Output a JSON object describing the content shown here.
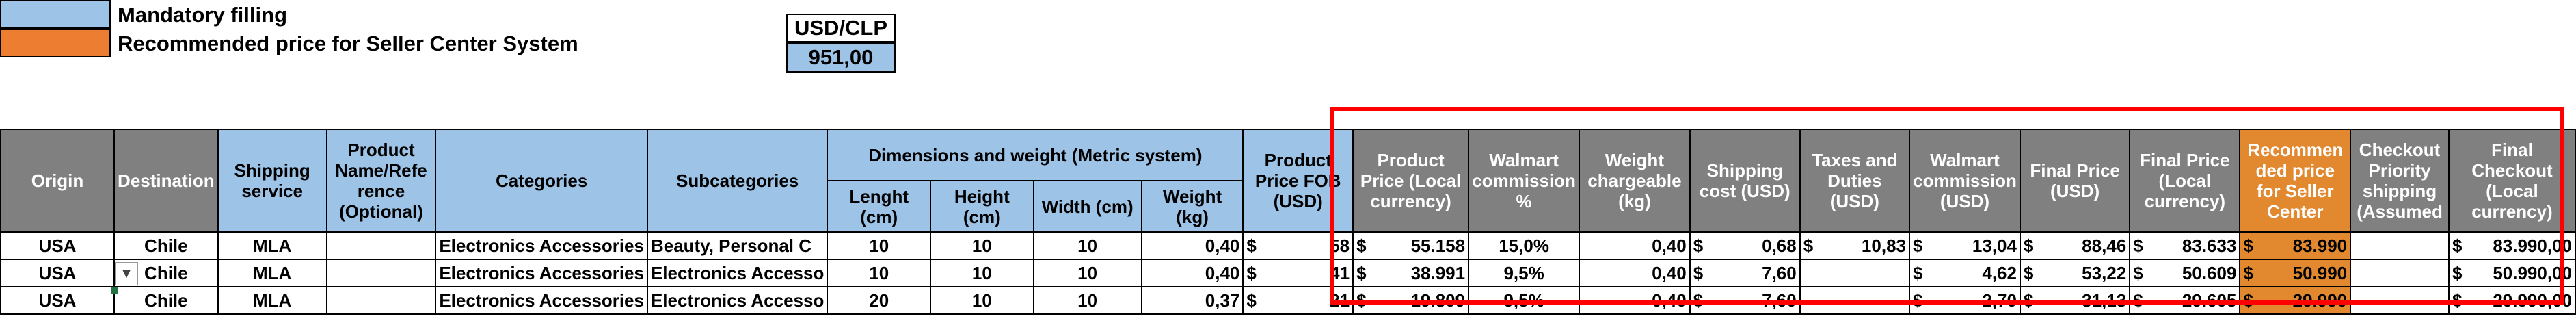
{
  "legend": {
    "mandatory_label": "Mandatory filling",
    "recommended_label": "Recommended price for Seller Center System",
    "mandatory_color": "#9dc3e6",
    "recommended_color": "#ed7d31"
  },
  "fx": {
    "label": "USD/CLP",
    "value": "951,00"
  },
  "headers": {
    "origin": "Origin",
    "destination": "Destination",
    "shipping_service": "Shipping service",
    "product_name": "Product Name/Refe rence (Optional)",
    "categories": "Categories",
    "subcategories": "Subcategories",
    "dimensions_group": "Dimensions and weight (Metric system)",
    "length": "Lenght (cm)",
    "height": "Height (cm)",
    "width": "Width (cm)",
    "weight": "Weight (kg)",
    "price_fob": "Product Price FOB (USD)",
    "price_local": "Product Price (Local currency)",
    "walmart_commission_pct": "Walmart commission %",
    "weight_chargeable": "Weight chargeable (kg)",
    "shipping_cost": "Shipping cost (USD)",
    "taxes": "Taxes and Duties (USD)",
    "walmart_commission_usd": "Walmart commission (USD)",
    "final_price_usd": "Final Price (USD)",
    "final_price_local": "Final Price (Local currency)",
    "recommended_price": "Recommen ded price for Seller Center",
    "checkout_priority": "Checkout Priority shipping (Assumed",
    "final_checkout": "Final Checkout (Local currency)"
  },
  "rows": [
    {
      "origin": "USA",
      "destination": "Chile",
      "service": "MLA",
      "name": "",
      "category": "Electronics Accessories",
      "subcategory": "Beauty, Personal C",
      "length": "10",
      "height": "10",
      "width": "10",
      "weight": "0,40",
      "fob_cur": "$",
      "fob": "58",
      "local_cur": "$",
      "local": "55.158",
      "commission_pct": "15,0%",
      "weight_chargeable": "0,40",
      "ship_cur": "$",
      "ship": "0,68",
      "tax_cur": "$",
      "tax": "10,83",
      "comm_cur": "$",
      "comm": "13,04",
      "final_usd_cur": "$",
      "final_usd": "88,46",
      "final_local_cur": "$",
      "final_local": "83.633",
      "rec_cur": "$",
      "rec": "83.990",
      "priority": "",
      "checkout_cur": "$",
      "checkout": "83.990,00"
    },
    {
      "origin": "USA",
      "destination": "Chile",
      "service": "MLA",
      "name": "",
      "category": "Electronics Accessories",
      "subcategory": "Electronics Accesso",
      "length": "10",
      "height": "10",
      "width": "10",
      "weight": "0,40",
      "fob_cur": "$",
      "fob": "41",
      "local_cur": "$",
      "local": "38.991",
      "commission_pct": "9,5%",
      "weight_chargeable": "0,40",
      "ship_cur": "$",
      "ship": "7,60",
      "tax_cur": "",
      "tax": "",
      "comm_cur": "$",
      "comm": "4,62",
      "final_usd_cur": "$",
      "final_usd": "53,22",
      "final_local_cur": "$",
      "final_local": "50.609",
      "rec_cur": "$",
      "rec": "50.990",
      "priority": "",
      "checkout_cur": "$",
      "checkout": "50.990,00"
    },
    {
      "origin": "USA",
      "destination": "Chile",
      "service": "MLA",
      "name": "",
      "category": "Electronics Accessories",
      "subcategory": "Electronics Accesso",
      "length": "20",
      "height": "10",
      "width": "10",
      "weight": "0,37",
      "fob_cur": "$",
      "fob": "21",
      "local_cur": "$",
      "local": "19.809",
      "commission_pct": "9,5%",
      "weight_chargeable": "0,40",
      "ship_cur": "$",
      "ship": "7,60",
      "tax_cur": "",
      "tax": "",
      "comm_cur": "$",
      "comm": "2,70",
      "final_usd_cur": "$",
      "final_usd": "31,13",
      "final_local_cur": "$",
      "final_local": "29.605",
      "rec_cur": "$",
      "rec": "29.990",
      "priority": "",
      "checkout_cur": "$",
      "checkout": "29.990,00"
    }
  ],
  "icons": {
    "dropdown": "dropdown-arrow-icon"
  }
}
